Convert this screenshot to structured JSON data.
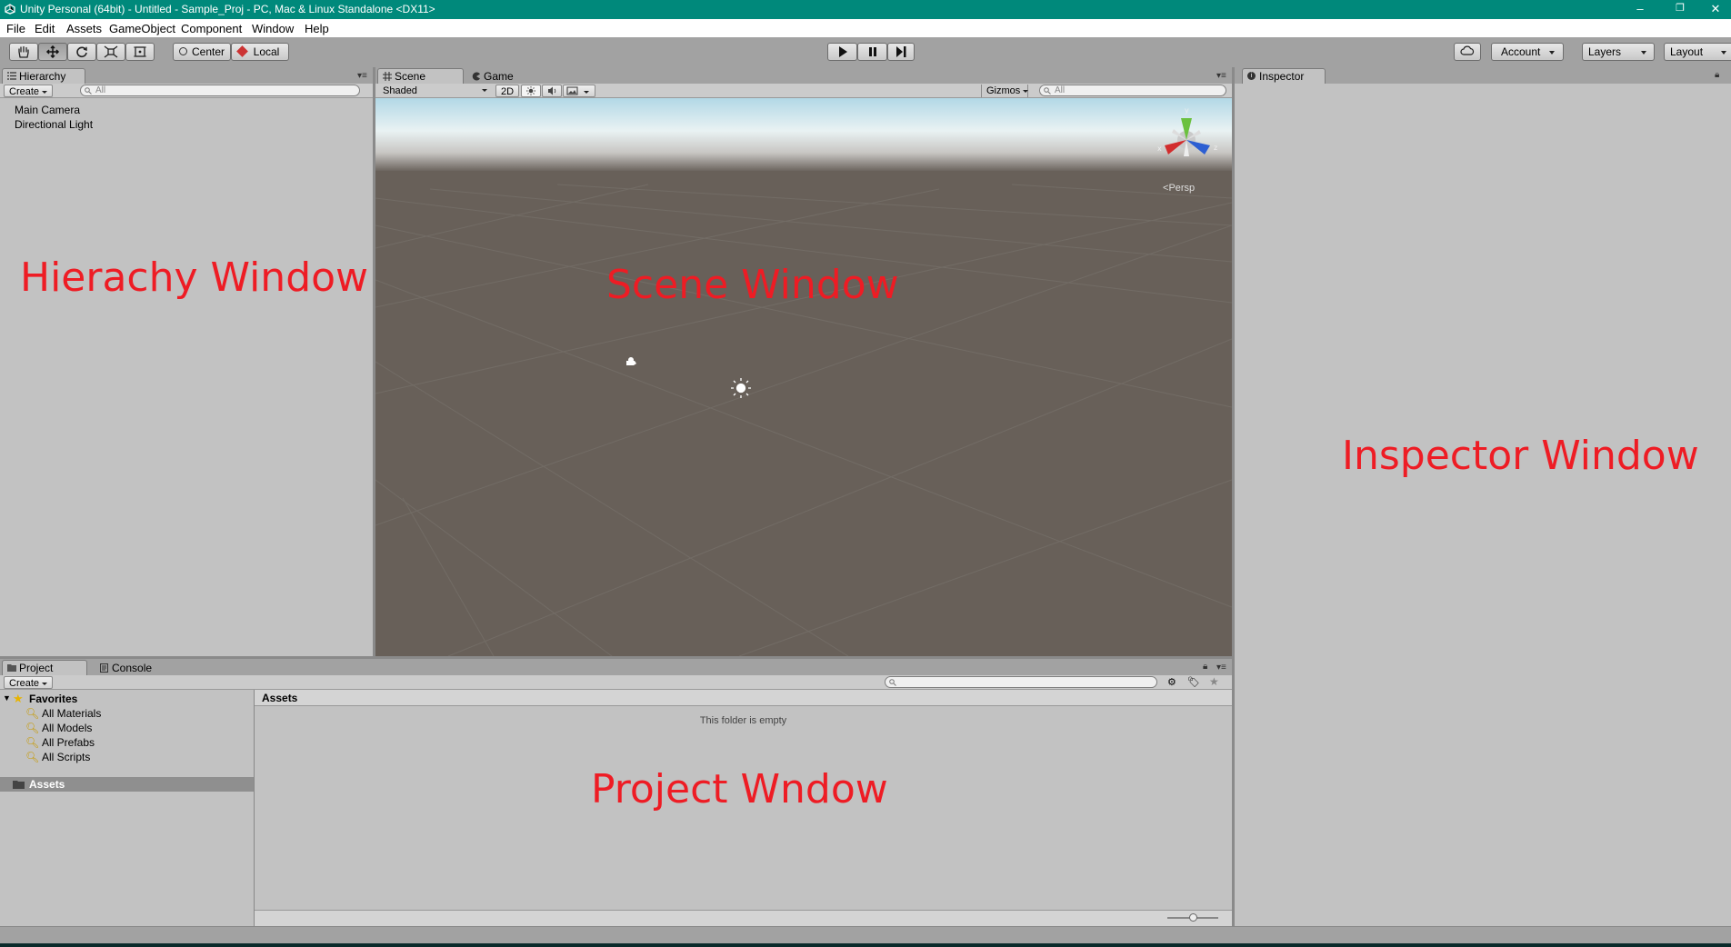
{
  "window": {
    "title": "Unity Personal (64bit) - Untitled - Sample_Proj - PC, Mac & Linux Standalone <DX11>",
    "minimize": "–",
    "restore": "❐",
    "close": "✕"
  },
  "menu": [
    "File",
    "Edit",
    "Assets",
    "GameObject",
    "Component",
    "Window",
    "Help"
  ],
  "toolbar": {
    "tools": [
      "hand-icon",
      "move-icon",
      "rotate-icon",
      "scale-icon",
      "rect-icon"
    ],
    "pivot_mode": "Center",
    "pivot_rotation": "Local",
    "account": "Account",
    "layers": "Layers",
    "layout": "Layout"
  },
  "hierarchy": {
    "tab": "Hierarchy",
    "create": "Create",
    "search_placeholder": "All",
    "items": [
      "Main Camera",
      "Directional Light"
    ]
  },
  "scene": {
    "tabs": [
      "Scene",
      "Game"
    ],
    "shading": "Shaded",
    "mode_2d": "2D",
    "gizmos": "Gizmos",
    "search_placeholder": "All",
    "projection": "Persp",
    "axes": {
      "y": "y",
      "x": "x",
      "z": "z"
    }
  },
  "inspector": {
    "tab": "Inspector"
  },
  "project": {
    "tabs": [
      "Project",
      "Console"
    ],
    "create": "Create",
    "favorites_label": "Favorites",
    "favorites": [
      "All Materials",
      "All Models",
      "All Prefabs",
      "All Scripts"
    ],
    "assets_label": "Assets",
    "breadcrumb": "Assets",
    "empty_text": "This folder is empty"
  },
  "annotations": {
    "hierarchy": "Hierachy Window",
    "scene": "Scene Window",
    "inspector": "Inspector Window",
    "project": "Project Wndow"
  },
  "colors": {
    "titlebar": "#00897b",
    "panel": "#c2c2c2",
    "scene_ground": "#686059",
    "annotation": "#ee1c24"
  }
}
